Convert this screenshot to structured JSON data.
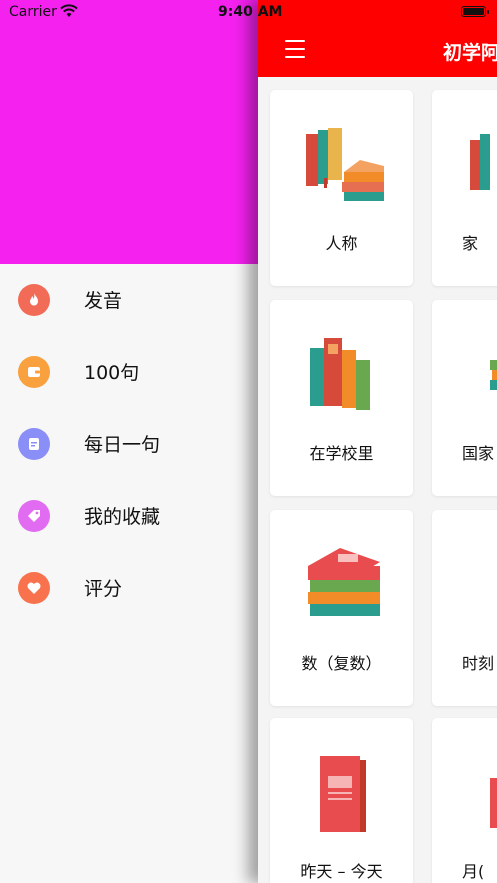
{
  "status_bar": {
    "carrier": "Carrier",
    "time": "9:40 AM"
  },
  "drawer": {
    "header_color": "#f521ef",
    "items": [
      {
        "label": "发音",
        "icon": "flame-icon",
        "color": "#f26b57"
      },
      {
        "label": "100句",
        "icon": "wallet-icon",
        "color": "#f9a03f"
      },
      {
        "label": "每日一句",
        "icon": "document-icon",
        "color": "#8a8ff7"
      },
      {
        "label": "我的收藏",
        "icon": "tag-icon",
        "color": "#e26cf1"
      },
      {
        "label": "评分",
        "icon": "heart-icon",
        "color": "#f8734d"
      }
    ]
  },
  "navbar": {
    "title": "初学阿",
    "color": "#fe0000"
  },
  "grid": {
    "cards": [
      {
        "label": "人称"
      },
      {
        "label": "家"
      },
      {
        "label": "在学校里"
      },
      {
        "label": "国家"
      },
      {
        "label": "数（复数）"
      },
      {
        "label": "时刻"
      },
      {
        "label": "昨天 – 今天"
      },
      {
        "label": "月("
      }
    ]
  }
}
